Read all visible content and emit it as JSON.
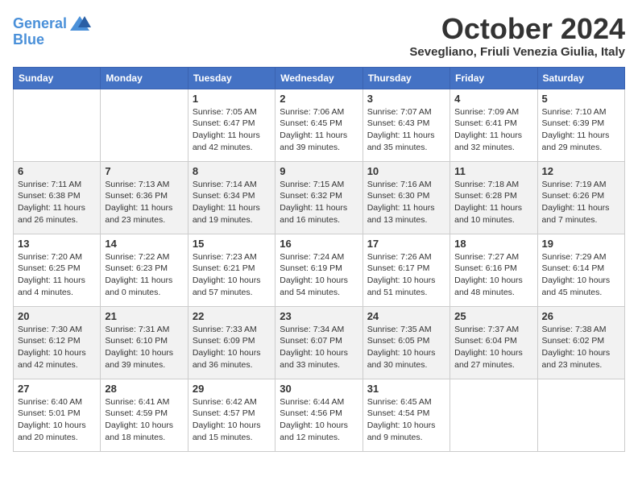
{
  "header": {
    "logo_line1": "General",
    "logo_line2": "Blue",
    "title": "October 2024",
    "subtitle": "Sevegliano, Friuli Venezia Giulia, Italy"
  },
  "days_of_week": [
    "Sunday",
    "Monday",
    "Tuesday",
    "Wednesday",
    "Thursday",
    "Friday",
    "Saturday"
  ],
  "weeks": [
    [
      {
        "day": "",
        "info": ""
      },
      {
        "day": "",
        "info": ""
      },
      {
        "day": "1",
        "info": "Sunrise: 7:05 AM\nSunset: 6:47 PM\nDaylight: 11 hours and 42 minutes."
      },
      {
        "day": "2",
        "info": "Sunrise: 7:06 AM\nSunset: 6:45 PM\nDaylight: 11 hours and 39 minutes."
      },
      {
        "day": "3",
        "info": "Sunrise: 7:07 AM\nSunset: 6:43 PM\nDaylight: 11 hours and 35 minutes."
      },
      {
        "day": "4",
        "info": "Sunrise: 7:09 AM\nSunset: 6:41 PM\nDaylight: 11 hours and 32 minutes."
      },
      {
        "day": "5",
        "info": "Sunrise: 7:10 AM\nSunset: 6:39 PM\nDaylight: 11 hours and 29 minutes."
      }
    ],
    [
      {
        "day": "6",
        "info": "Sunrise: 7:11 AM\nSunset: 6:38 PM\nDaylight: 11 hours and 26 minutes."
      },
      {
        "day": "7",
        "info": "Sunrise: 7:13 AM\nSunset: 6:36 PM\nDaylight: 11 hours and 23 minutes."
      },
      {
        "day": "8",
        "info": "Sunrise: 7:14 AM\nSunset: 6:34 PM\nDaylight: 11 hours and 19 minutes."
      },
      {
        "day": "9",
        "info": "Sunrise: 7:15 AM\nSunset: 6:32 PM\nDaylight: 11 hours and 16 minutes."
      },
      {
        "day": "10",
        "info": "Sunrise: 7:16 AM\nSunset: 6:30 PM\nDaylight: 11 hours and 13 minutes."
      },
      {
        "day": "11",
        "info": "Sunrise: 7:18 AM\nSunset: 6:28 PM\nDaylight: 11 hours and 10 minutes."
      },
      {
        "day": "12",
        "info": "Sunrise: 7:19 AM\nSunset: 6:26 PM\nDaylight: 11 hours and 7 minutes."
      }
    ],
    [
      {
        "day": "13",
        "info": "Sunrise: 7:20 AM\nSunset: 6:25 PM\nDaylight: 11 hours and 4 minutes."
      },
      {
        "day": "14",
        "info": "Sunrise: 7:22 AM\nSunset: 6:23 PM\nDaylight: 11 hours and 0 minutes."
      },
      {
        "day": "15",
        "info": "Sunrise: 7:23 AM\nSunset: 6:21 PM\nDaylight: 10 hours and 57 minutes."
      },
      {
        "day": "16",
        "info": "Sunrise: 7:24 AM\nSunset: 6:19 PM\nDaylight: 10 hours and 54 minutes."
      },
      {
        "day": "17",
        "info": "Sunrise: 7:26 AM\nSunset: 6:17 PM\nDaylight: 10 hours and 51 minutes."
      },
      {
        "day": "18",
        "info": "Sunrise: 7:27 AM\nSunset: 6:16 PM\nDaylight: 10 hours and 48 minutes."
      },
      {
        "day": "19",
        "info": "Sunrise: 7:29 AM\nSunset: 6:14 PM\nDaylight: 10 hours and 45 minutes."
      }
    ],
    [
      {
        "day": "20",
        "info": "Sunrise: 7:30 AM\nSunset: 6:12 PM\nDaylight: 10 hours and 42 minutes."
      },
      {
        "day": "21",
        "info": "Sunrise: 7:31 AM\nSunset: 6:10 PM\nDaylight: 10 hours and 39 minutes."
      },
      {
        "day": "22",
        "info": "Sunrise: 7:33 AM\nSunset: 6:09 PM\nDaylight: 10 hours and 36 minutes."
      },
      {
        "day": "23",
        "info": "Sunrise: 7:34 AM\nSunset: 6:07 PM\nDaylight: 10 hours and 33 minutes."
      },
      {
        "day": "24",
        "info": "Sunrise: 7:35 AM\nSunset: 6:05 PM\nDaylight: 10 hours and 30 minutes."
      },
      {
        "day": "25",
        "info": "Sunrise: 7:37 AM\nSunset: 6:04 PM\nDaylight: 10 hours and 27 minutes."
      },
      {
        "day": "26",
        "info": "Sunrise: 7:38 AM\nSunset: 6:02 PM\nDaylight: 10 hours and 23 minutes."
      }
    ],
    [
      {
        "day": "27",
        "info": "Sunrise: 6:40 AM\nSunset: 5:01 PM\nDaylight: 10 hours and 20 minutes."
      },
      {
        "day": "28",
        "info": "Sunrise: 6:41 AM\nSunset: 4:59 PM\nDaylight: 10 hours and 18 minutes."
      },
      {
        "day": "29",
        "info": "Sunrise: 6:42 AM\nSunset: 4:57 PM\nDaylight: 10 hours and 15 minutes."
      },
      {
        "day": "30",
        "info": "Sunrise: 6:44 AM\nSunset: 4:56 PM\nDaylight: 10 hours and 12 minutes."
      },
      {
        "day": "31",
        "info": "Sunrise: 6:45 AM\nSunset: 4:54 PM\nDaylight: 10 hours and 9 minutes."
      },
      {
        "day": "",
        "info": ""
      },
      {
        "day": "",
        "info": ""
      }
    ]
  ]
}
